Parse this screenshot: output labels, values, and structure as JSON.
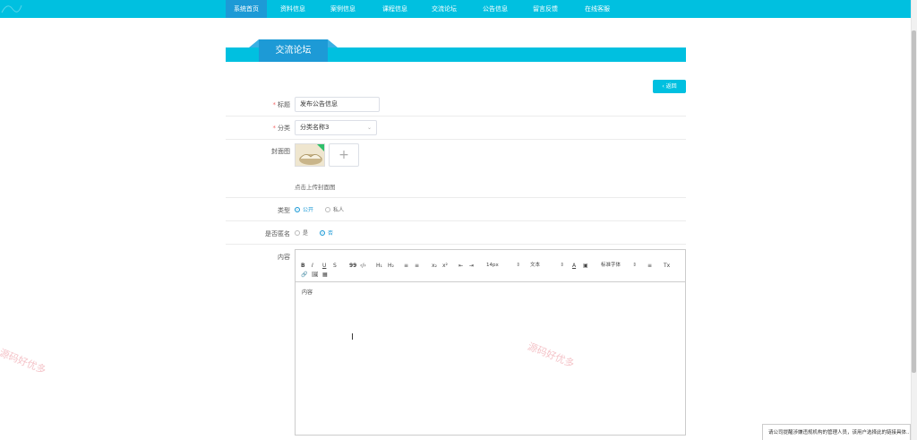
{
  "nav": {
    "items": [
      "系统首页",
      "资料信息",
      "案例信息",
      "课程信息",
      "交流论坛",
      "公告信息",
      "留言反馈",
      "在线客服"
    ],
    "active_index": 0,
    "bg_color": "#00c0e0",
    "active_color": "#1d9ad6"
  },
  "section": {
    "title": "交流论坛"
  },
  "back_button": {
    "icon": "chevron-left-icon",
    "label": "返回"
  },
  "form": {
    "title": {
      "label": "标题",
      "value": "发布公告信息"
    },
    "category": {
      "label": "分类",
      "value": "分类名称3"
    },
    "cover": {
      "label": "封面图",
      "upload_icon": "plus-icon",
      "hint": "点击上传封面图"
    },
    "type": {
      "label": "类型",
      "options": [
        "公开",
        "私人"
      ],
      "selected": "公开"
    },
    "anonymous": {
      "label": "是否匿名",
      "options": [
        "是",
        "否"
      ],
      "selected": "否"
    },
    "content": {
      "label": "内容",
      "text": "内容"
    }
  },
  "editor_toolbar": {
    "buttons": [
      "B",
      "I",
      "U",
      "S",
      "99",
      "‹/›",
      "H₁",
      "H₂",
      "≡",
      "≡",
      "x₂",
      "x²",
      "⇤",
      "⇥",
      "A",
      "▣",
      "≡",
      "Tx",
      "🔗",
      "🖼",
      "▦"
    ],
    "font_size": "14px",
    "block_format": "文本",
    "font_family": "标准字体"
  },
  "watermark_text": "源码好优多",
  "bottom_notice": "请公司提醒涉嫌违规机构的管理人员，该用户选择此的链接具体..."
}
